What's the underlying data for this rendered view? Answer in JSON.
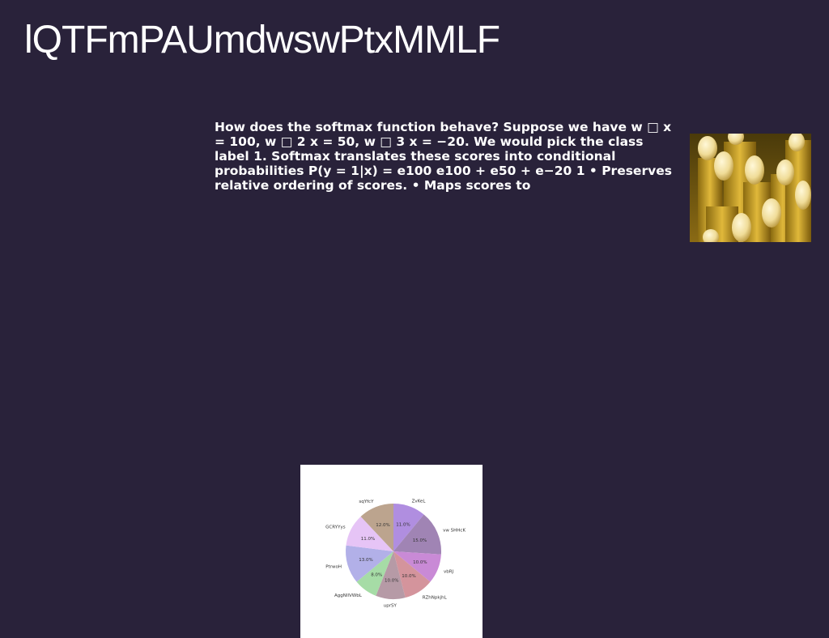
{
  "slide": {
    "title": "lQTFmPAUmdwswPtxMMLF",
    "body": "How does the softmax function behave? Suppose we have w □ x = 100, w □ 2 x = 50, w □ 3 x = −20. We would pick the class label 1. Softmax translates these scores into conditional probabilities P(y = 1|x) = e100 e100 + e50 + e−20 1 • Preserves relative ordering of scores. • Maps scores to"
  },
  "chart_data": {
    "type": "pie",
    "title": "",
    "categories": [
      "ZvKeL",
      "vw SHHcK",
      "vbRJ",
      "RZhNpkjhL",
      "uprSY",
      "AggNlIVWbL",
      "PtrwoH",
      "GCRYYys",
      "sqYfcY"
    ],
    "values": [
      11.0,
      15.0,
      10.0,
      10.0,
      10.0,
      8.0,
      13.0,
      11.0,
      12.0
    ],
    "value_labels": [
      "11.0%",
      "15.0%",
      "10.0%",
      "10.0%",
      "10.0%",
      "8.0%",
      "13.0%",
      "11.0%",
      "12.0%"
    ],
    "colors": [
      "#b08ee0",
      "#a084b4",
      "#c98ad6",
      "#d4949c",
      "#b69aa6",
      "#a6dca6",
      "#b2b0e8",
      "#e6c4f6",
      "#bca48e"
    ],
    "start_angle_deg": 90,
    "direction": "clockwise",
    "legend": "none"
  }
}
